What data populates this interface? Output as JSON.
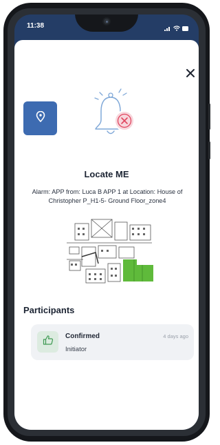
{
  "status": {
    "time": "11:38"
  },
  "alarm_sheet": {
    "title": "Locate ME",
    "description": "Alarm: APP from:  Luca B APP 1 at Location: House of Christopher P_H1-5- Ground Floor_zone4",
    "close_icon": "close-icon",
    "location_icon": "location-pin-icon",
    "alarm_icon": "bell-icon",
    "accent_color": "#3d6bb1",
    "alarm_badge_color": "#e0465f"
  },
  "participants": {
    "heading": "Participants",
    "items": [
      {
        "status": "Confirmed",
        "role": "Initiator",
        "time": "4 days ago",
        "icon": "thumbs-up-icon"
      }
    ]
  }
}
